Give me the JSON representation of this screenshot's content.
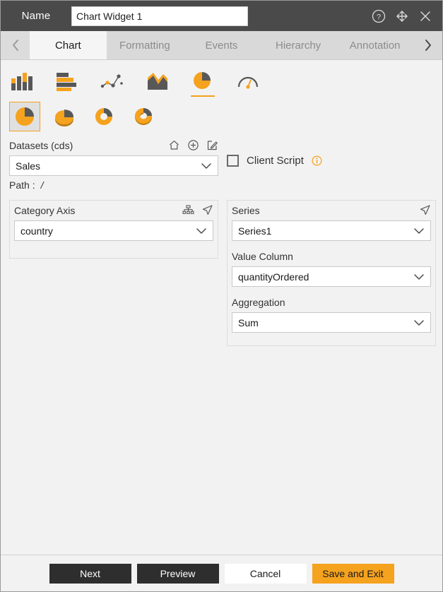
{
  "titlebar": {
    "name_label": "Name",
    "widget_name": "Chart Widget 1",
    "name_placeholder": "Chart Widget 1",
    "icons": [
      "help-icon",
      "move-icon",
      "close-icon"
    ]
  },
  "tabbar": {
    "prev_arrow": "chevron-left-icon",
    "next_arrow": "chevron-right-icon",
    "tabs": [
      {
        "label": "Chart",
        "active": true
      },
      {
        "label": "Formatting",
        "active": false
      },
      {
        "label": "Events",
        "active": false
      },
      {
        "label": "Hierarchy",
        "active": false
      },
      {
        "label": "Annotation",
        "active": false
      }
    ]
  },
  "chart_types": {
    "primary": [
      {
        "name": "column-chart-icon",
        "selected": false
      },
      {
        "name": "bar-chart-icon",
        "selected": false
      },
      {
        "name": "scatter-line-chart-icon",
        "selected": false
      },
      {
        "name": "area-chart-icon",
        "selected": false
      },
      {
        "name": "pie-chart-icon",
        "selected": true
      },
      {
        "name": "gauge-chart-icon",
        "selected": false
      }
    ],
    "subtypes": [
      {
        "name": "pie-icon",
        "selected": true
      },
      {
        "name": "pie-3d-icon",
        "selected": false
      },
      {
        "name": "donut-icon",
        "selected": false
      },
      {
        "name": "donut-3d-icon",
        "selected": false
      }
    ]
  },
  "datasets": {
    "label": "Datasets (cds)",
    "icons": [
      "home-icon",
      "add-circle-icon",
      "edit-icon"
    ],
    "selected": "Sales",
    "options": [
      "Sales"
    ],
    "path_label": "Path :",
    "path_value": "/"
  },
  "client_script": {
    "label": "Client Script",
    "checked": false,
    "info_icon": "info-icon"
  },
  "category_axis": {
    "label": "Category Axis",
    "icons": [
      "hierarchy-icon",
      "navigate-icon"
    ],
    "selected": "country",
    "options": [
      "country"
    ]
  },
  "series": {
    "label": "Series",
    "icons": [
      "navigate-icon"
    ],
    "selected": "Series1",
    "options": [
      "Series1"
    ],
    "value_column_label": "Value Column",
    "value_column_selected": "quantityOrdered",
    "value_column_options": [
      "quantityOrdered"
    ],
    "aggregation_label": "Aggregation",
    "aggregation_selected": "Sum",
    "aggregation_options": [
      "Sum"
    ]
  },
  "footer": {
    "next": "Next",
    "preview": "Preview",
    "cancel": "Cancel",
    "save_and_exit": "Save and Exit"
  },
  "colors": {
    "accent": "#f5a21e",
    "titlebar_bg": "#4a4a4a",
    "tabbar_bg": "#d9d9d9",
    "panel_bg": "#f2f2f2",
    "dark_button": "#2e2e2e",
    "icon_gray": "#585858"
  }
}
